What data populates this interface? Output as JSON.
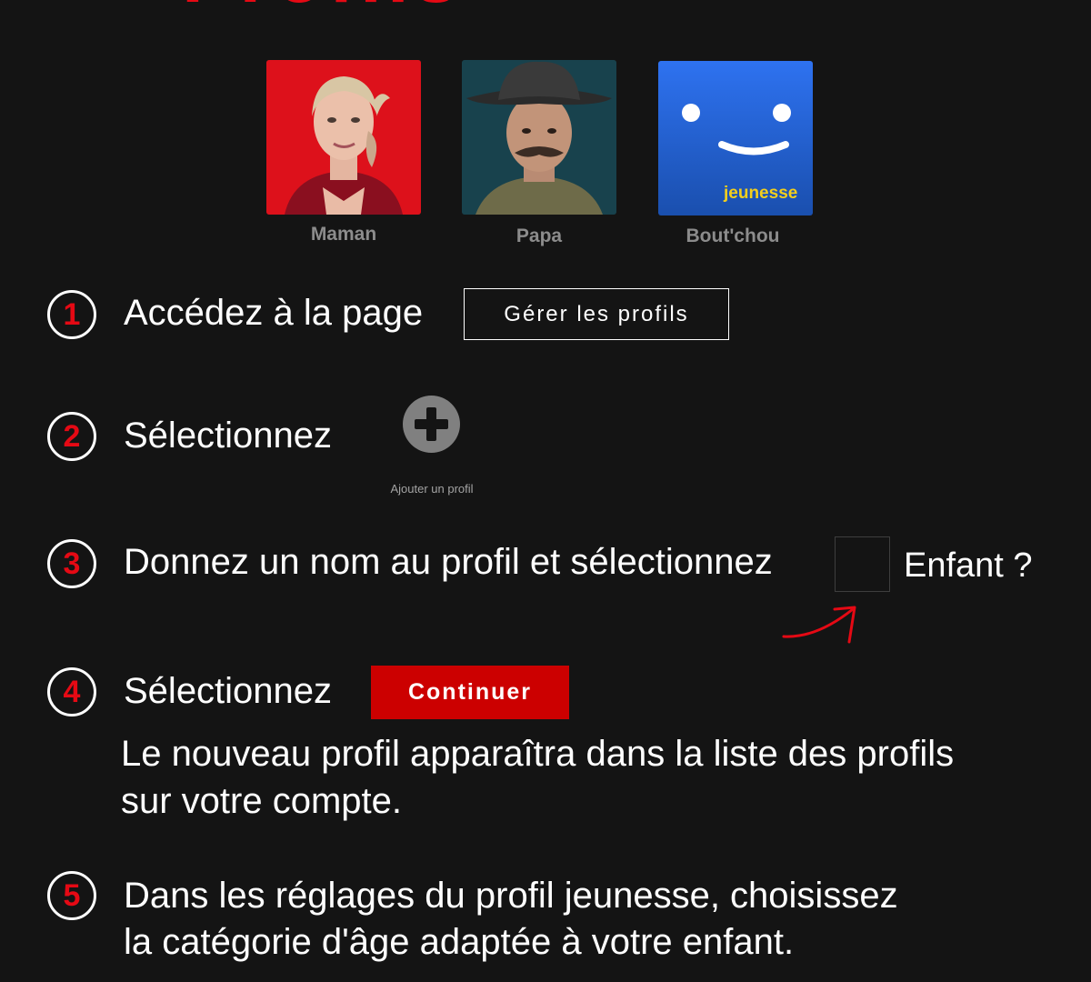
{
  "header": {
    "title_partial": "Profils"
  },
  "profiles": [
    {
      "name": "Maman",
      "avatar": "woman-portrait-avatar"
    },
    {
      "name": "Papa",
      "avatar": "man-with-hat-portrait-avatar"
    },
    {
      "name": "Bout'chou",
      "avatar": "smiley-face-icon",
      "badge": "jeunesse"
    }
  ],
  "steps": [
    {
      "number": "1",
      "text": "Accédez à la page",
      "button": "Gérer les profils"
    },
    {
      "number": "2",
      "text": "Sélectionnez",
      "add_label": "Ajouter un profil",
      "icon": "plus-icon"
    },
    {
      "number": "3",
      "text": "Donnez un nom au profil et sélectionnez",
      "checkbox_label": "Enfant ?"
    },
    {
      "number": "4",
      "text": "Sélectionnez",
      "button": "Continuer",
      "note_line1": "Le nouveau profil apparaîtra dans la liste des profils",
      "note_line2": "sur votre compte."
    },
    {
      "number": "5",
      "text_line1": "Dans les réglages du profil jeunesse, choisissez",
      "text_line2": "la catégorie d'âge adaptée à votre enfant."
    }
  ],
  "colors": {
    "accent": "#e50914",
    "button_red": "#cc0000",
    "background": "#141414",
    "kids_blue": "#1f5fd1",
    "kids_yellow": "#f3cf1c"
  }
}
